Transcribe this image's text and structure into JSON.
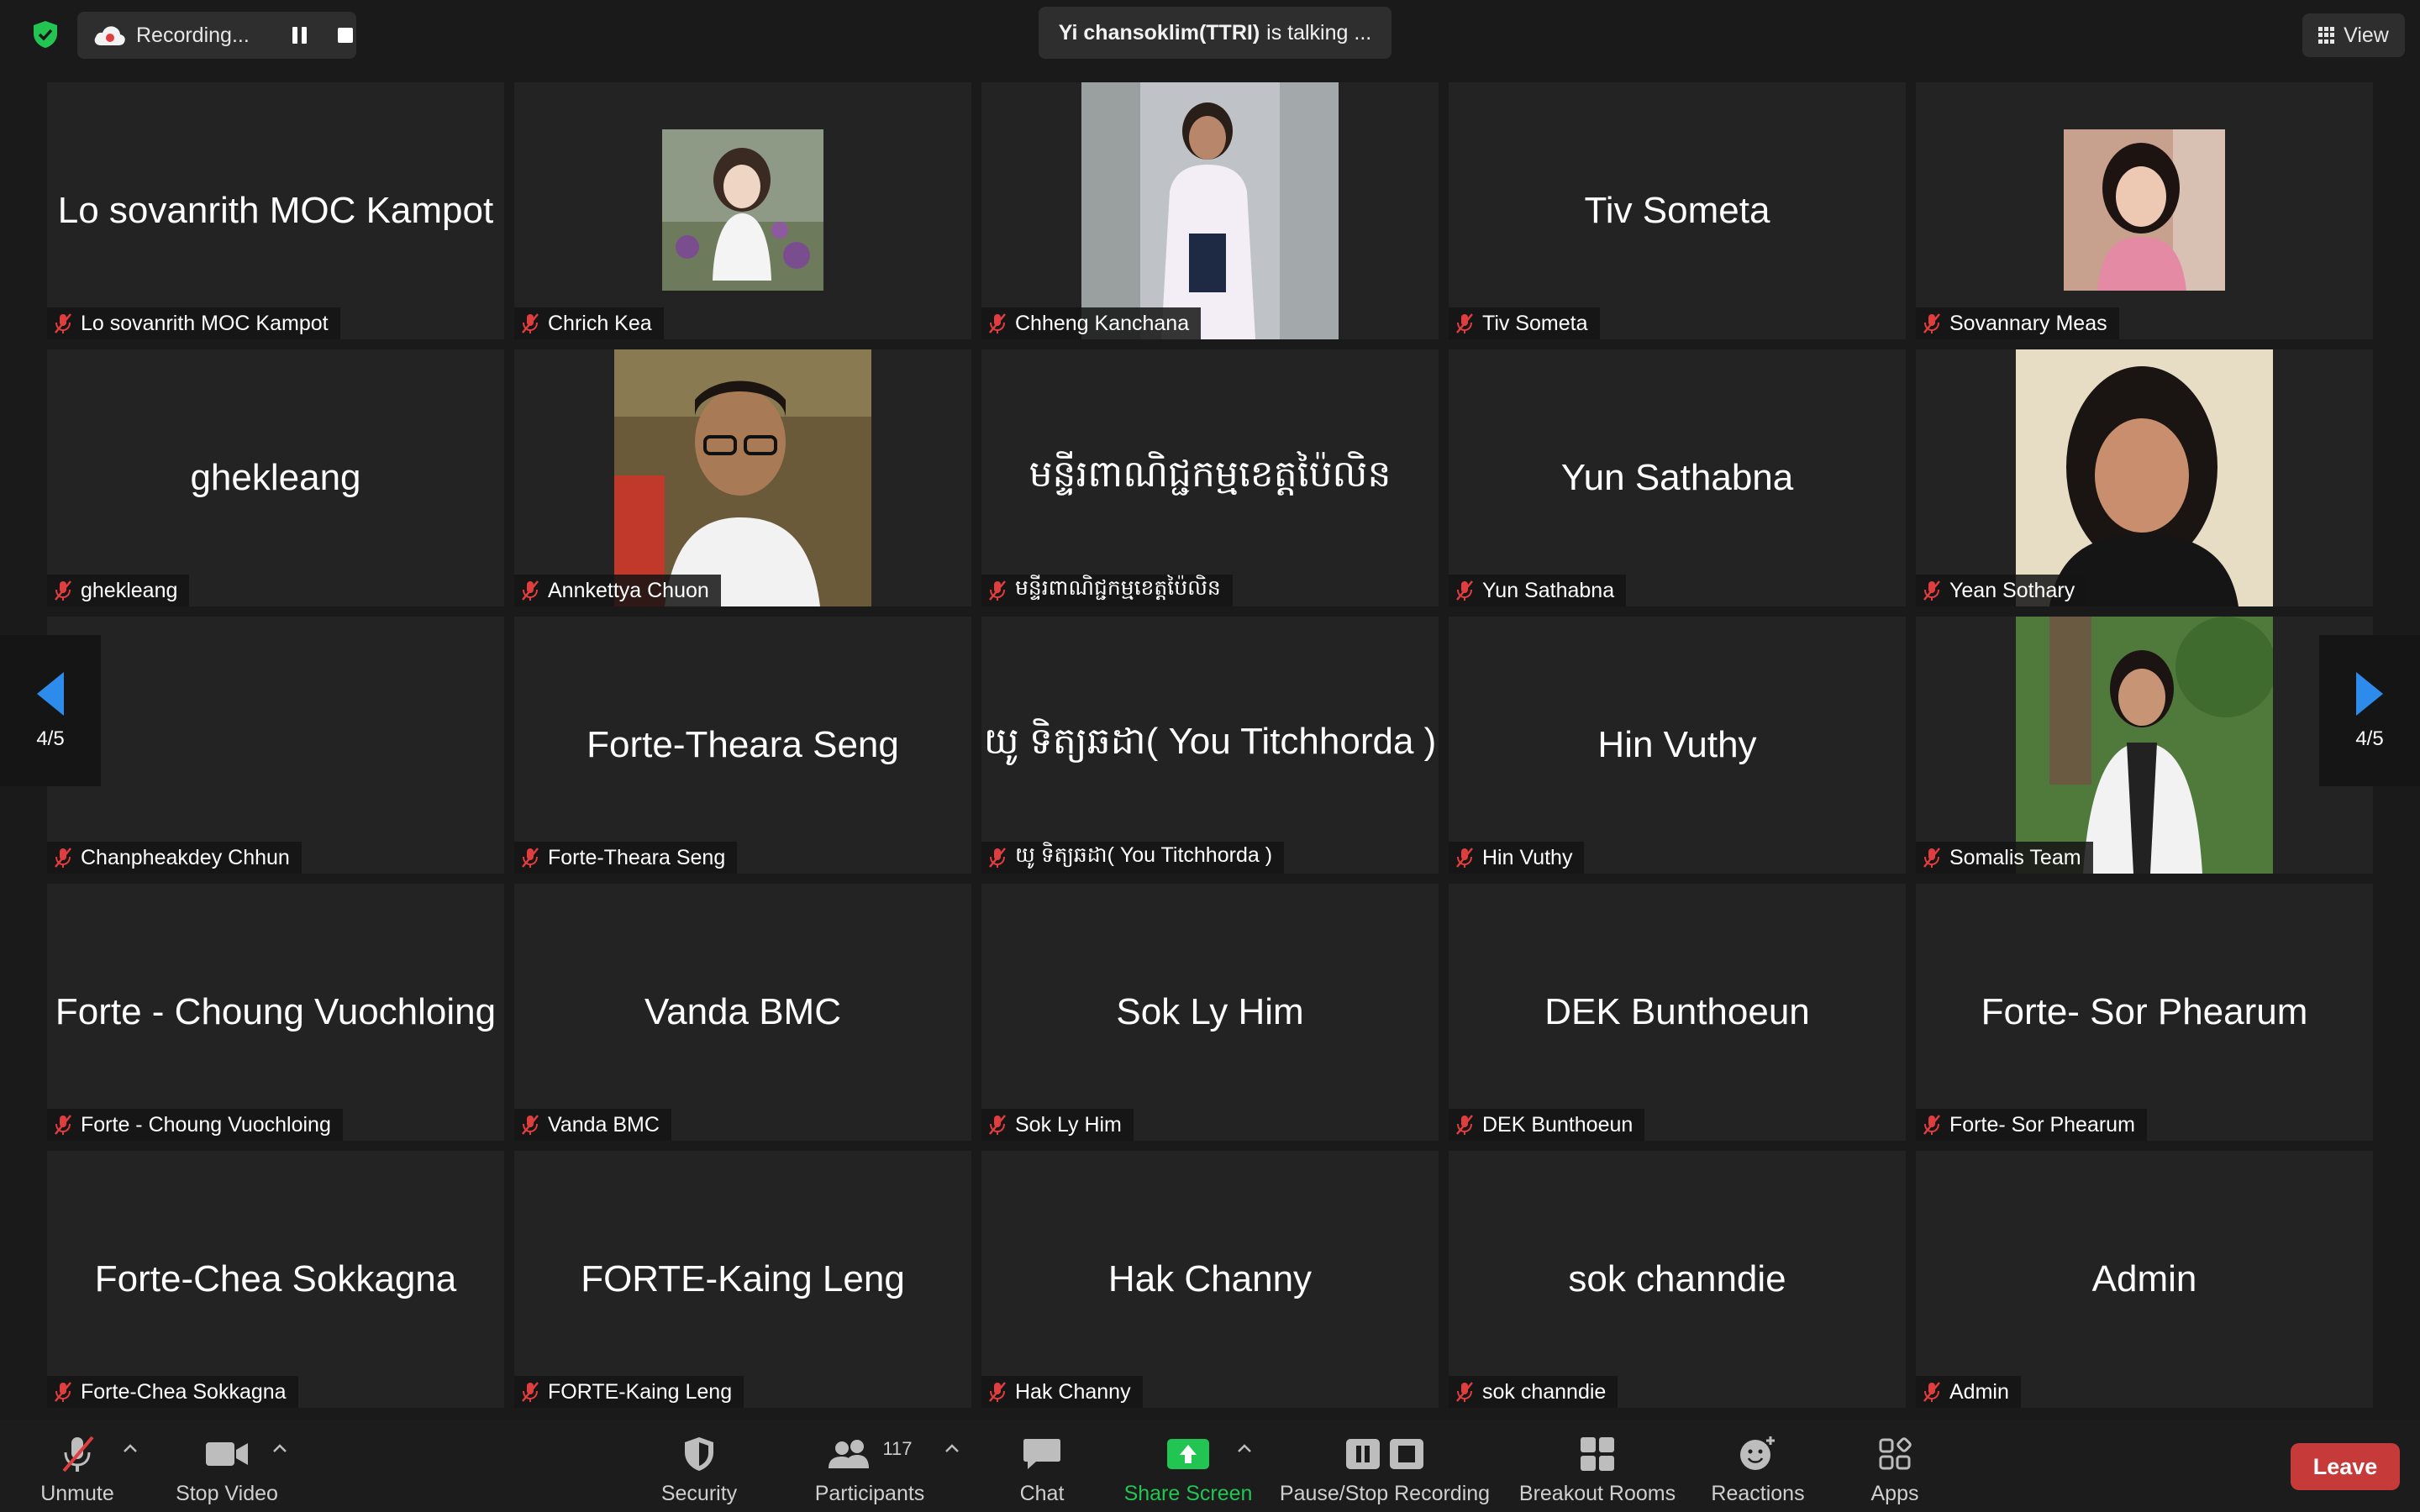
{
  "top": {
    "recording_label": "Recording...",
    "talking_name": "Yi chansoklim(TTRI)",
    "talking_suffix": "is talking ...",
    "view_label": "View"
  },
  "grid": {
    "tiles": [
      {
        "center": "Lo sovanrith MOC Kampot",
        "label": "Lo sovanrith MOC Kampot"
      },
      {
        "center": "",
        "label": "Chrich Kea"
      },
      {
        "center": "",
        "label": "Chheng Kanchana"
      },
      {
        "center": "Tiv Someta",
        "label": "Tiv Someta"
      },
      {
        "center": "",
        "label": "Sovannary Meas"
      },
      {
        "center": "ghekleang",
        "label": "ghekleang"
      },
      {
        "center": "",
        "label": "Annkettya Chuon"
      },
      {
        "center": "មន្ទីរពាណិជ្ជកម្មខេត្តប៉ៃលិន",
        "label": "មន្ទីរពាណិជ្ជកម្មខេត្តប៉ៃលិន"
      },
      {
        "center": "Yun Sathabna",
        "label": "Yun Sathabna"
      },
      {
        "center": "",
        "label": "Yean Sothary"
      },
      {
        "center": "",
        "label": "Chanpheakdey Chhun"
      },
      {
        "center": "Forte-Theara Seng",
        "label": "Forte-Theara Seng"
      },
      {
        "center": "យូ ទិត្យឆដា( You Titchhorda )",
        "label": "យូ ទិត្យឆដា( You Titchhorda )"
      },
      {
        "center": "Hin Vuthy",
        "label": "Hin Vuthy"
      },
      {
        "center": "",
        "label": "Somalis Team"
      },
      {
        "center": "Forte - Choung Vuochloing",
        "label": "Forte - Choung Vuochloing"
      },
      {
        "center": "Vanda BMC",
        "label": "Vanda BMC"
      },
      {
        "center": "Sok Ly Him",
        "label": "Sok Ly Him"
      },
      {
        "center": "DEK Bunthoeun",
        "label": "DEK Bunthoeun"
      },
      {
        "center": "Forte- Sor Phearum",
        "label": "Forte- Sor Phearum"
      },
      {
        "center": "Forte-Chea Sokkagna",
        "label": "Forte-Chea Sokkagna"
      },
      {
        "center": "FORTE-Kaing Leng",
        "label": "FORTE-Kaing Leng"
      },
      {
        "center": "Hak Channy",
        "label": "Hak Channy"
      },
      {
        "center": "sok channdie",
        "label": "sok channdie"
      },
      {
        "center": "Admin",
        "label": "Admin"
      }
    ]
  },
  "nav": {
    "page_left": "4/5",
    "page_right": "4/5"
  },
  "toolbar": {
    "unmute": "Unmute",
    "stop_video": "Stop Video",
    "security": "Security",
    "participants": "Participants",
    "participants_count": "117",
    "chat": "Chat",
    "share_screen": "Share Screen",
    "pause_stop_recording": "Pause/Stop Recording",
    "breakout_rooms": "Breakout Rooms",
    "reactions": "Reactions",
    "apps": "Apps",
    "leave": "Leave"
  },
  "colors": {
    "share_green": "#23c552",
    "leave_red": "#c73a3a",
    "nav_blue": "#2d8ceb",
    "mute_red": "#e03e3e"
  }
}
